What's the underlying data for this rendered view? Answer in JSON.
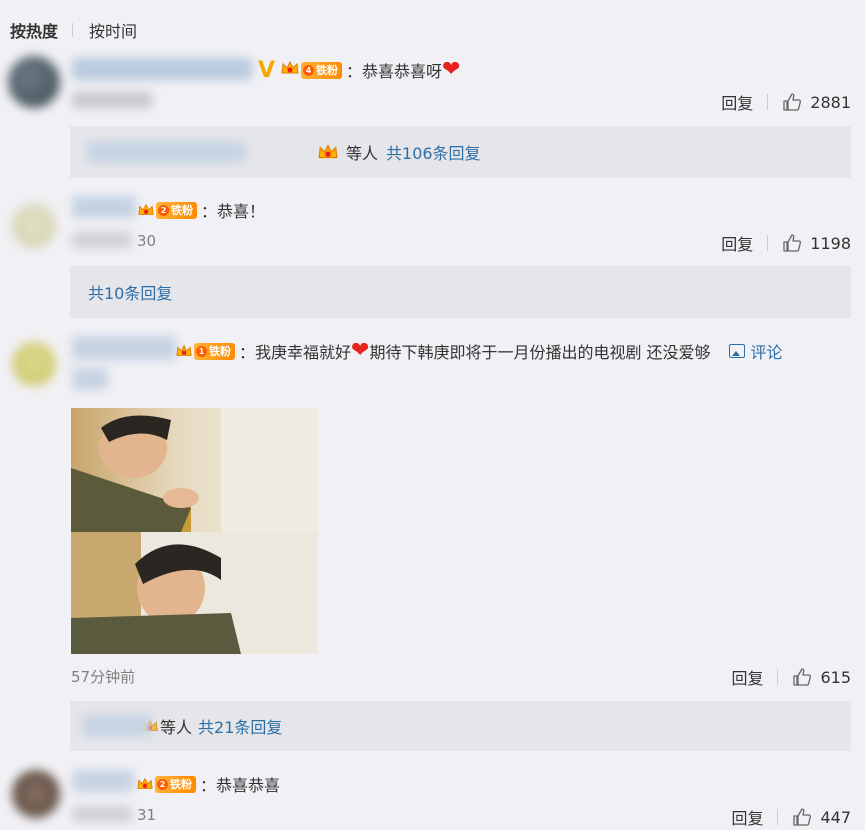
{
  "sort": {
    "hot": "按热度",
    "time": "按时间"
  },
  "comments": [
    {
      "verified_mark": "V",
      "fan_label": "铁粉",
      "fan_level": "4",
      "text": "：恭喜恭喜呀",
      "actions": {
        "reply": "回复",
        "likes": "2881"
      },
      "sub": {
        "crown_level": "1",
        "others": "等人",
        "link": "共106条回复"
      }
    },
    {
      "fan_label": "铁粉",
      "fan_level": "2",
      "text": "：恭喜！",
      "time": "30",
      "actions": {
        "reply": "回复",
        "likes": "1198"
      },
      "sub": {
        "link": "共10条回复"
      }
    },
    {
      "fan_label": "铁粉",
      "fan_level": "1",
      "text_before_heart": "：我庚幸福就好",
      "text_after_heart": "期待下韩庚即将于一月份播出的电视剧 还没爱够",
      "comment_link": "评论",
      "time": "57分钟前",
      "actions": {
        "reply": "回复",
        "likes": "615"
      },
      "sub": {
        "crown_level": "2",
        "others": "等人",
        "link": "共21条回复"
      }
    },
    {
      "fan_label": "铁粉",
      "fan_level": "2",
      "text": "：恭喜恭喜",
      "time": "31",
      "actions": {
        "reply": "回复",
        "likes": "447"
      }
    }
  ],
  "colors": {
    "link": "#2c6ea6",
    "background": "#f1f1f5",
    "subbox": "#e6e6ea",
    "heart": "#e8221c",
    "badge": "#ff9a1e"
  }
}
